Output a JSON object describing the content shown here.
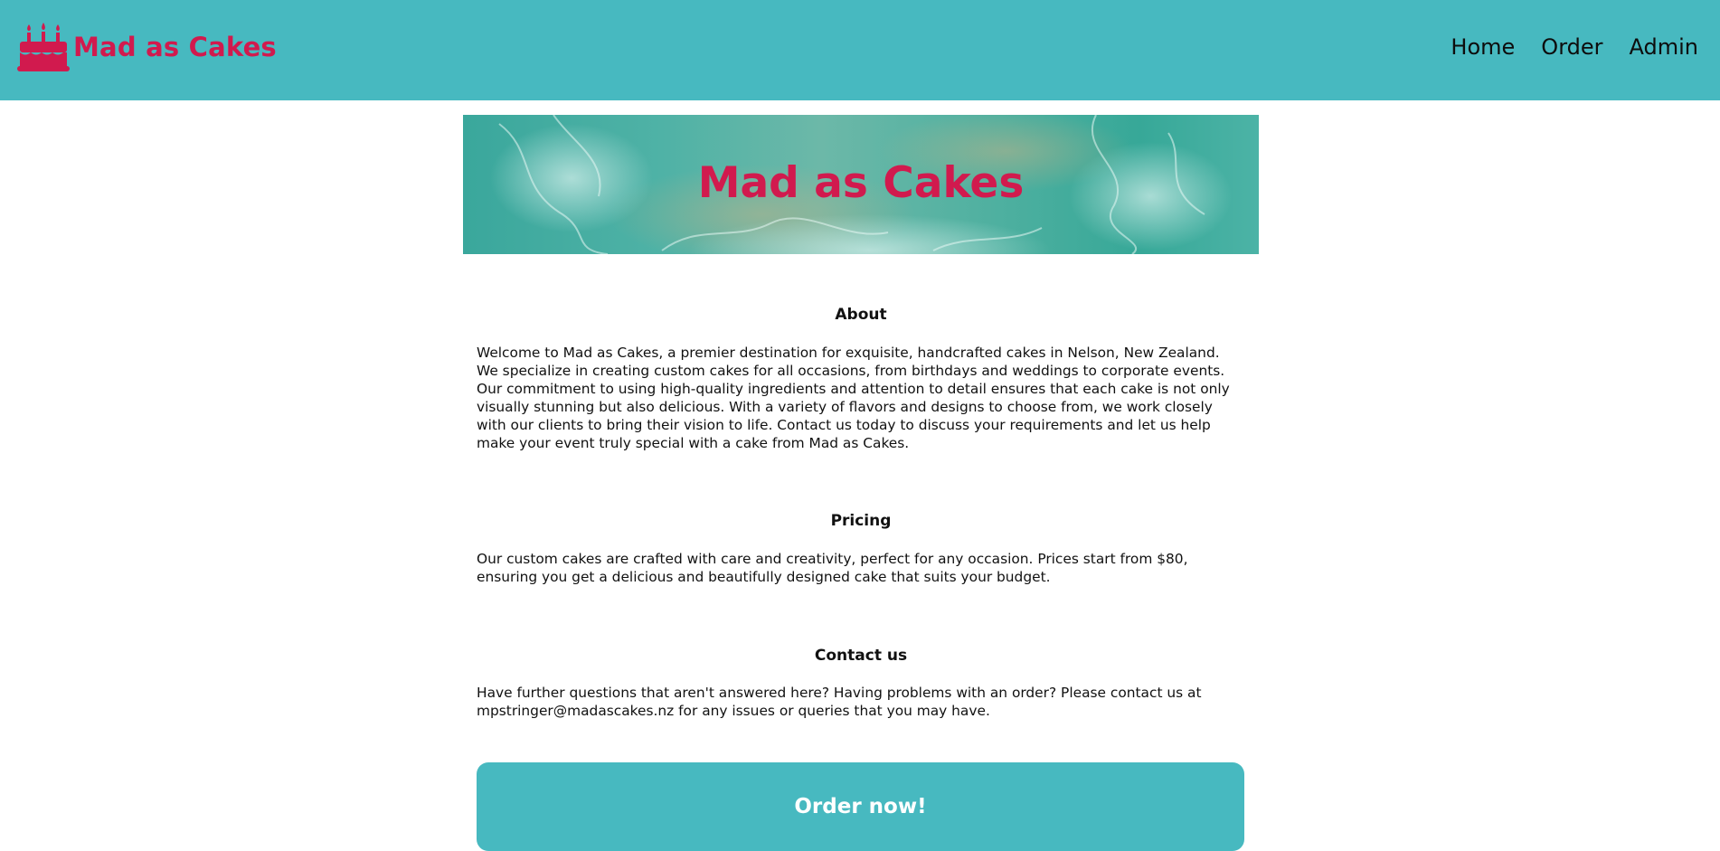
{
  "brand": {
    "name": "Mad as Cakes",
    "icon": "birthday-cake-icon",
    "color": "#d11a4e"
  },
  "nav": {
    "items": [
      {
        "label": "Home"
      },
      {
        "label": "Order"
      },
      {
        "label": "Admin"
      }
    ]
  },
  "hero": {
    "title": "Mad as Cakes"
  },
  "sections": {
    "about": {
      "title": "About",
      "text": "Welcome to Mad as Cakes, a premier destination for exquisite, handcrafted cakes in Nelson, New Zealand. We specialize in creating custom cakes for all occasions, from birthdays and weddings to corporate events. Our commitment to using high-quality ingredients and attention to detail ensures that each cake is not only visually stunning but also delicious. With a variety of flavors and designs to choose from, we work closely with our clients to bring their vision to life. Contact us today to discuss your requirements and let us help make your event truly special with a cake from Mad as Cakes."
    },
    "pricing": {
      "title": "Pricing",
      "text": "Our custom cakes are crafted with care and creativity, perfect for any occasion. Prices start from $80, ensuring you get a delicious and beautifully designed cake that suits your budget."
    },
    "contact": {
      "title": "Contact us",
      "text": "Have further questions that aren't answered here? Having problems with an order? Please contact us at mpstringer@madascakes.nz for any issues or queries that you may have."
    }
  },
  "cta": {
    "label": "Order now!"
  },
  "colors": {
    "accent": "#47b9c0",
    "brand": "#d11a4e"
  }
}
